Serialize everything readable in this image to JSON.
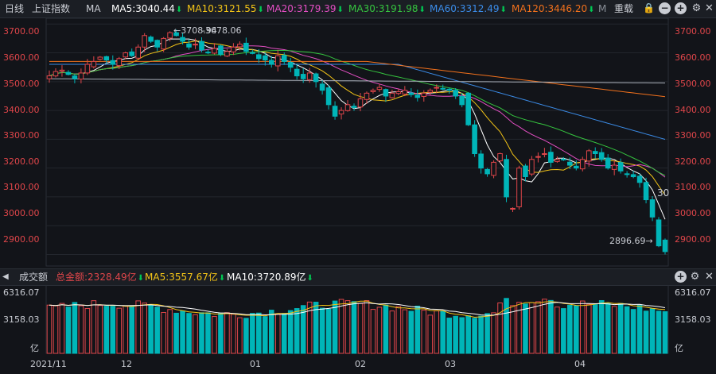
{
  "header": {
    "period": "日线",
    "index_name": "上证指数",
    "ma_label": "MA",
    "ma5": "MA5:3040.44",
    "ma10": "MA10:3121.55",
    "ma20": "MA20:3179.39",
    "ma30": "MA30:3191.98",
    "ma60": "MA60:3312.49",
    "ma120": "MA120:3446.20",
    "more": "M",
    "restore_label": "重载"
  },
  "volume_header": {
    "title": "成交额",
    "total": "总金额:2328.49亿",
    "ma5": "MA5:3557.67亿",
    "ma10": "MA10:3720.89亿"
  },
  "colors": {
    "up": "#e0464a",
    "down": "#00b5b8",
    "ma5": "#ffffff",
    "ma10": "#f3c417",
    "ma20": "#e44fc4",
    "ma30": "#35c43f",
    "ma60": "#3b8ce8",
    "ma120": "#f2711c",
    "ma250": "#aab0ba"
  },
  "price_axis": [
    "3700.00",
    "3600.00",
    "3500.00",
    "3400.00",
    "3300.00",
    "3200.00",
    "3100.00",
    "3000.00",
    "2900.00"
  ],
  "volume_axis": [
    "6316.07",
    "3158.03",
    "亿"
  ],
  "date_axis": [
    "2021/11",
    "12",
    "01",
    "02",
    "03",
    "04"
  ],
  "annotations": {
    "high": "3708.94",
    "high2": "3678.06",
    "low": "2896.69",
    "right_tag": "30"
  },
  "chart_data": {
    "type": "candlestick",
    "ylim": [
      2860,
      3720
    ],
    "closes": [
      3520,
      3535,
      3540,
      3525,
      3510,
      3530,
      3560,
      3570,
      3585,
      3575,
      3560,
      3580,
      3600,
      3590,
      3620,
      3660,
      3640,
      3620,
      3650,
      3670,
      3660,
      3640,
      3620,
      3630,
      3610,
      3600,
      3615,
      3595,
      3605,
      3620,
      3630,
      3605,
      3600,
      3580,
      3575,
      3560,
      3590,
      3570,
      3550,
      3520,
      3510,
      3530,
      3500,
      3470,
      3420,
      3380,
      3400,
      3420,
      3410,
      3440,
      3460,
      3470,
      3480,
      3450,
      3460,
      3465,
      3470,
      3455,
      3445,
      3460,
      3470,
      3480,
      3475,
      3470,
      3450,
      3420,
      3350,
      3250,
      3200,
      3180,
      3220,
      3250,
      3100,
      3060,
      3200,
      3170,
      3230,
      3240,
      3250,
      3220,
      3230,
      3230,
      3210,
      3200,
      3230,
      3260,
      3250,
      3230,
      3200,
      3210,
      3190,
      3180,
      3170,
      3150,
      3090,
      3030,
      2930,
      2910
    ]
  }
}
